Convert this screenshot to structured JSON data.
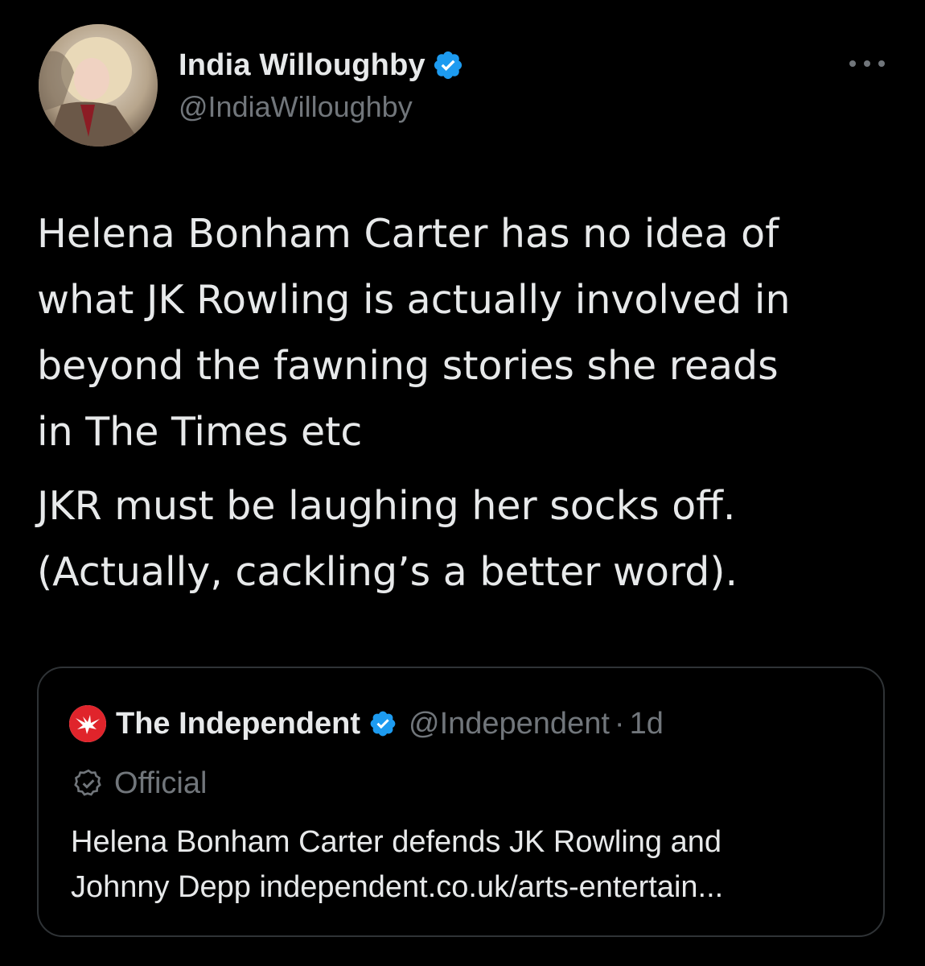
{
  "author": {
    "display_name": "India Willoughby",
    "handle": "@IndiaWilloughby",
    "verified": true
  },
  "tweet": {
    "paragraphs": [
      "Helena Bonham Carter has no idea of\nwhat JK Rowling is actually involved in\nbeyond the fawning stories she reads\nin The Times etc",
      "JKR must be laughing her socks off.\n(Actually, cackling’s a better word)."
    ]
  },
  "quote": {
    "display_name": "The Independent",
    "handle": "@Independent",
    "separator": "·",
    "time": "1d",
    "badge_label": "Official",
    "text_line1": "Helena Bonham Carter defends JK Rowling and",
    "text_line2": "Johnny Depp independent.co.uk/arts-entertain..."
  },
  "colors": {
    "background": "#000000",
    "primary_text": "#e7e9ea",
    "secondary_text": "#71767b",
    "verified_blue": "#1d9bf0",
    "card_border": "#2f3336",
    "independent_red": "#e0242b"
  },
  "icons": {
    "more": "more-horizontal-icon",
    "verified": "verified-badge-icon",
    "official": "official-badge-icon",
    "logo": "independent-eagle-logo"
  }
}
